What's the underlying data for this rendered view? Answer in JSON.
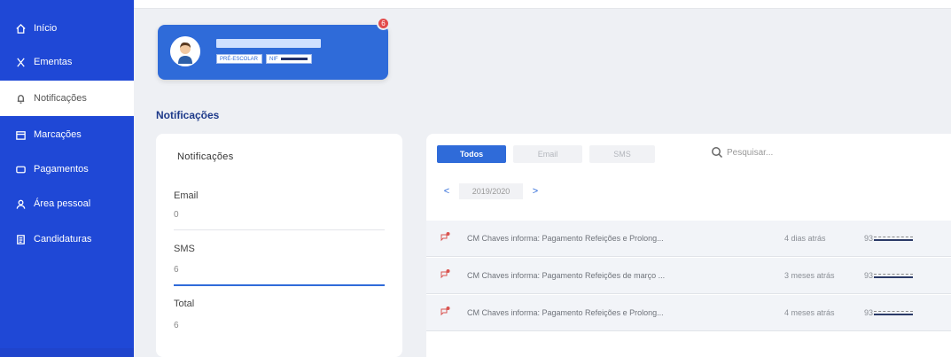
{
  "sidebar": {
    "items": [
      {
        "label": "Início",
        "icon": "home-icon"
      },
      {
        "label": "Ementas",
        "icon": "cutlery-icon"
      },
      {
        "label": "Notificações",
        "icon": "bell-icon",
        "active": true
      },
      {
        "label": "Marcações",
        "icon": "calendar-icon"
      },
      {
        "label": "Pagamentos",
        "icon": "card-icon"
      },
      {
        "label": "Área pessoal",
        "icon": "user-icon"
      },
      {
        "label": "Candidaturas",
        "icon": "document-icon"
      }
    ]
  },
  "profile": {
    "school_tag": "PRÉ-ESCOLAR",
    "nif_tag": "NIF",
    "badge": "6"
  },
  "page": {
    "title": "Notificações"
  },
  "stats": {
    "header": "Notificações",
    "email_label": "Email",
    "email_value": "0",
    "sms_label": "SMS",
    "sms_value": "6",
    "total_label": "Total",
    "total_value": "6"
  },
  "filters": {
    "all": "Todos",
    "email": "Email",
    "sms": "SMS",
    "selected": "Todos"
  },
  "search": {
    "placeholder": "Pesquisar..."
  },
  "year_nav": {
    "prev": "<",
    "year": "2019/2020",
    "next": ">"
  },
  "notifications": [
    {
      "message": "CM Chaves informa: Pagamento Refeições e Prolong...",
      "when": "4 dias atrás",
      "phone_prefix": "93"
    },
    {
      "message": "CM Chaves informa: Pagamento Refeições de março ...",
      "when": "3 meses atrás",
      "phone_prefix": "93"
    },
    {
      "message": "CM Chaves informa: Pagamento Refeições e Prolong...",
      "when": "4 meses atrás",
      "phone_prefix": "93"
    }
  ],
  "colors": {
    "brand": "#1f48d6",
    "accent": "#2f6bd9",
    "badge": "#e24b4b"
  }
}
